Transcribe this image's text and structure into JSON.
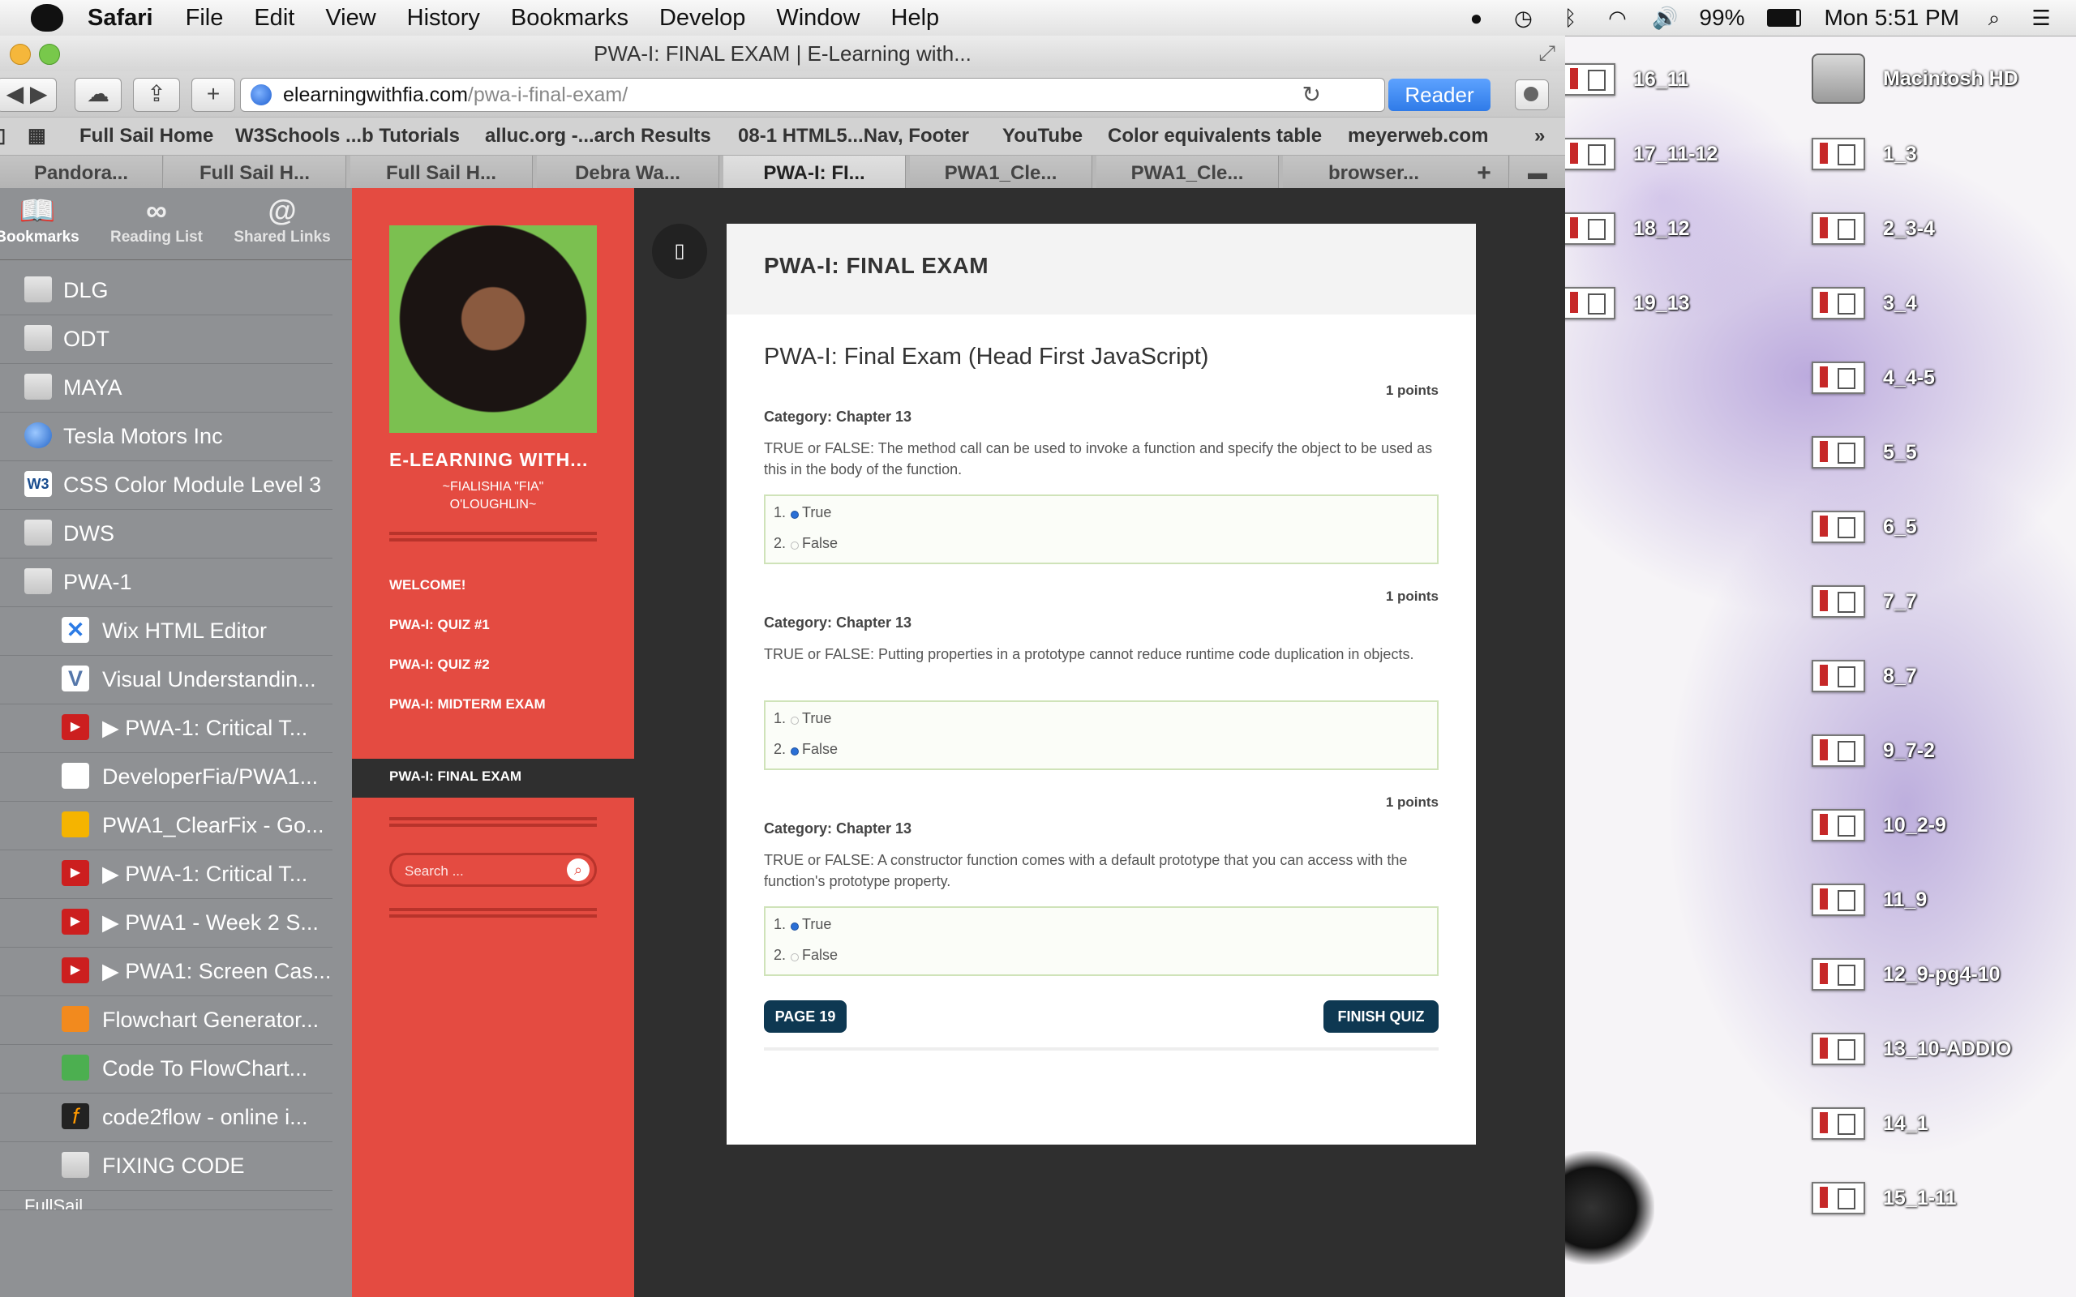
{
  "menubar": {
    "app": "Safari",
    "items": [
      "File",
      "Edit",
      "View",
      "History",
      "Bookmarks",
      "Develop",
      "Window",
      "Help"
    ],
    "battery": "99%",
    "clock": "Mon 5:51 PM"
  },
  "window": {
    "title": "PWA-I: FINAL EXAM | E-Learning with...",
    "url_host": "elearningwithfia.com",
    "url_path": "/pwa-i-final-exam/",
    "reader": "Reader"
  },
  "bookmarks_bar": [
    "Full Sail Home",
    "W3Schools ...b Tutorials",
    "alluc.org -...arch Results",
    "08-1 HTML5...Nav, Footer",
    "YouTube",
    "Color equivalents table",
    "meyerweb.com"
  ],
  "tabs": [
    "Pandora...",
    "Full Sail H...",
    "Full Sail H...",
    "Debra Wa...",
    "PWA-I: FI...",
    "PWA1_Cle...",
    "PWA1_Cle...",
    "browser..."
  ],
  "sidebar": {
    "tabs": [
      "Bookmarks",
      "Reading List",
      "Shared Links"
    ],
    "items": [
      "DLG",
      "ODT",
      "MAYA",
      "Tesla Motors Inc",
      "CSS Color Module Level 3",
      "DWS",
      "PWA-1",
      "Wix HTML Editor",
      "Visual Understandin...",
      "▶ PWA-1: Critical T...",
      "DeveloperFia/PWA1...",
      "PWA1_ClearFix - Go...",
      "▶ PWA-1: Critical T...",
      "▶ PWA1 - Week 2 S...",
      "▶ PWA1: Screen Cas...",
      "Flowchart Generator...",
      "Code To FlowChart...",
      "code2flow - online i...",
      "FIXING CODE",
      "FullSail"
    ]
  },
  "site": {
    "title": "E-LEARNING WITH...",
    "subtitle_line1": "~FIALISHIA \"FIA\"",
    "subtitle_line2": "O'LOUGHLIN~",
    "nav": [
      "WELCOME!",
      "PWA-I: QUIZ #1",
      "PWA-I: QUIZ #2",
      "PWA-I: MIDTERM EXAM",
      "PWA-I: FINAL EXAM"
    ],
    "search_placeholder": "Search ..."
  },
  "content": {
    "header": "PWA-I: FINAL EXAM",
    "quiz_title": "PWA-I: Final Exam (Head First JavaScript)",
    "questions": [
      {
        "points": "1 points",
        "category": "Category: Chapter 13",
        "text": "TRUE or FALSE:  The method call can be used to invoke a function and specify the object to be used as this in the body of the function.",
        "answers": [
          "True",
          "False"
        ],
        "selected": 0
      },
      {
        "points": "1 points",
        "category": "Category: Chapter 13",
        "text": "TRUE or FALSE:  Putting properties in a prototype cannot reduce runtime code duplication in objects.",
        "answers": [
          "True",
          "False"
        ],
        "selected": 1
      },
      {
        "points": "1 points",
        "category": "Category: Chapter 13",
        "text": "TRUE or FALSE:  A constructor function comes with a default prototype that you can access with the function's prototype property.",
        "answers": [
          "True",
          "False"
        ],
        "selected": 0
      }
    ],
    "page_button": "PAGE 19",
    "finish_button": "FINISH QUIZ"
  },
  "desktop": {
    "left_column": [
      "16_11",
      "17_11-12",
      "18_12",
      "19_13"
    ],
    "right_column": [
      "Macintosh HD",
      "1_3",
      "2_3-4",
      "3_4",
      "4_4-5",
      "5_5",
      "6_5",
      "7_7",
      "8_7",
      "9_7-2",
      "10_2-9",
      "11_9",
      "12_9-pg4-10",
      "13_10-ADDIO",
      "14_1",
      "15_1-11"
    ]
  },
  "colors": {
    "accent_red": "#e44b41",
    "button_navy": "#0e3852",
    "reader_blue": "#2f7be8"
  }
}
